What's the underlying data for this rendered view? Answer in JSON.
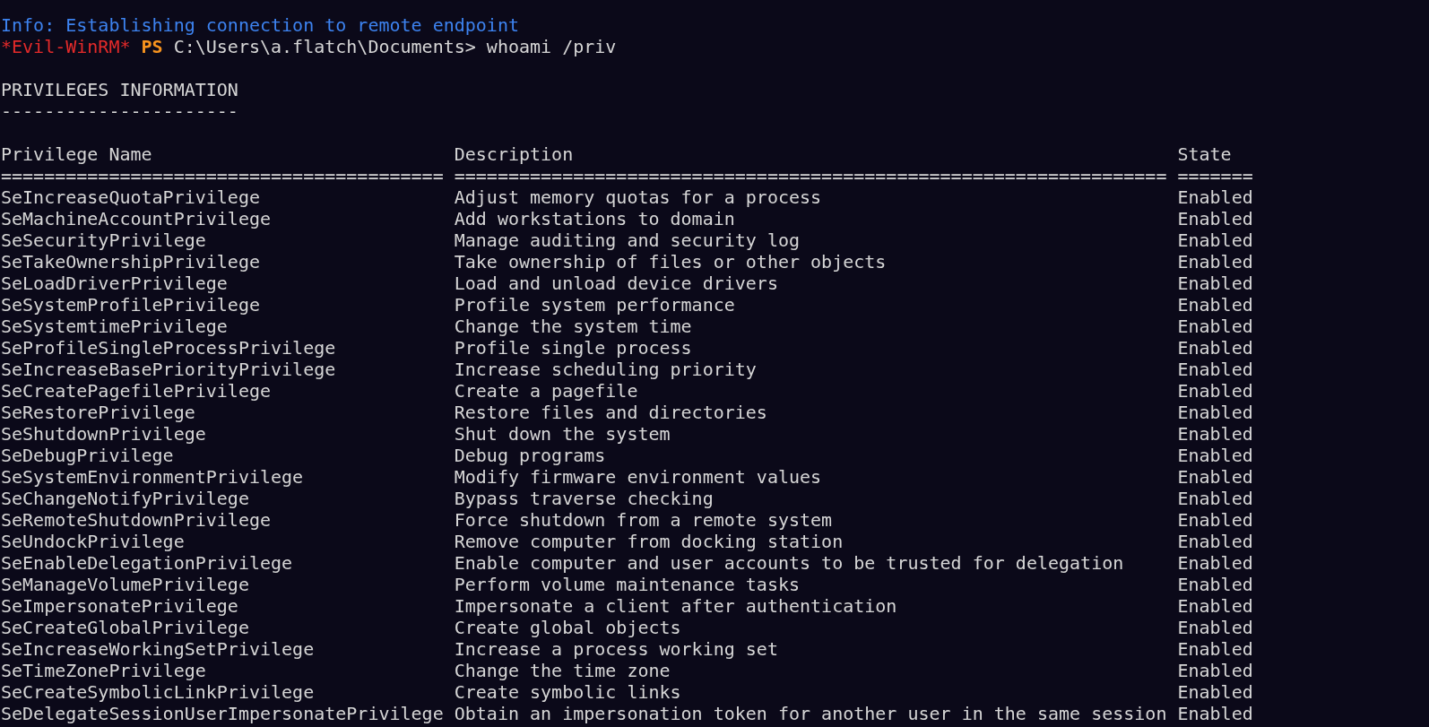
{
  "info_line": "Info: Establishing connection to remote endpoint",
  "prompt": {
    "shell_tag": "*Evil-WinRM*",
    "ps": "PS",
    "path": "C:\\Users\\a.flatch\\Documents>",
    "command": "whoami /priv"
  },
  "section": {
    "title": "PRIVILEGES INFORMATION",
    "underline": "----------------------"
  },
  "table": {
    "columns": [
      {
        "label": "Privilege Name",
        "rule": "========================================="
      },
      {
        "label": "Description",
        "rule": "=================================================================="
      },
      {
        "label": "State",
        "rule": "======="
      }
    ],
    "rows": [
      {
        "name": "SeIncreaseQuotaPrivilege",
        "description": "Adjust memory quotas for a process",
        "state": "Enabled"
      },
      {
        "name": "SeMachineAccountPrivilege",
        "description": "Add workstations to domain",
        "state": "Enabled"
      },
      {
        "name": "SeSecurityPrivilege",
        "description": "Manage auditing and security log",
        "state": "Enabled"
      },
      {
        "name": "SeTakeOwnershipPrivilege",
        "description": "Take ownership of files or other objects",
        "state": "Enabled"
      },
      {
        "name": "SeLoadDriverPrivilege",
        "description": "Load and unload device drivers",
        "state": "Enabled"
      },
      {
        "name": "SeSystemProfilePrivilege",
        "description": "Profile system performance",
        "state": "Enabled"
      },
      {
        "name": "SeSystemtimePrivilege",
        "description": "Change the system time",
        "state": "Enabled"
      },
      {
        "name": "SeProfileSingleProcessPrivilege",
        "description": "Profile single process",
        "state": "Enabled"
      },
      {
        "name": "SeIncreaseBasePriorityPrivilege",
        "description": "Increase scheduling priority",
        "state": "Enabled"
      },
      {
        "name": "SeCreatePagefilePrivilege",
        "description": "Create a pagefile",
        "state": "Enabled"
      },
      {
        "name": "SeRestorePrivilege",
        "description": "Restore files and directories",
        "state": "Enabled"
      },
      {
        "name": "SeShutdownPrivilege",
        "description": "Shut down the system",
        "state": "Enabled"
      },
      {
        "name": "SeDebugPrivilege",
        "description": "Debug programs",
        "state": "Enabled"
      },
      {
        "name": "SeSystemEnvironmentPrivilege",
        "description": "Modify firmware environment values",
        "state": "Enabled"
      },
      {
        "name": "SeChangeNotifyPrivilege",
        "description": "Bypass traverse checking",
        "state": "Enabled"
      },
      {
        "name": "SeRemoteShutdownPrivilege",
        "description": "Force shutdown from a remote system",
        "state": "Enabled"
      },
      {
        "name": "SeUndockPrivilege",
        "description": "Remove computer from docking station",
        "state": "Enabled"
      },
      {
        "name": "SeEnableDelegationPrivilege",
        "description": "Enable computer and user accounts to be trusted for delegation",
        "state": "Enabled"
      },
      {
        "name": "SeManageVolumePrivilege",
        "description": "Perform volume maintenance tasks",
        "state": "Enabled"
      },
      {
        "name": "SeImpersonatePrivilege",
        "description": "Impersonate a client after authentication",
        "state": "Enabled"
      },
      {
        "name": "SeCreateGlobalPrivilege",
        "description": "Create global objects",
        "state": "Enabled"
      },
      {
        "name": "SeIncreaseWorkingSetPrivilege",
        "description": "Increase a process working set",
        "state": "Enabled"
      },
      {
        "name": "SeTimeZonePrivilege",
        "description": "Change the time zone",
        "state": "Enabled"
      },
      {
        "name": "SeCreateSymbolicLinkPrivilege",
        "description": "Create symbolic links",
        "state": "Enabled"
      },
      {
        "name": "SeDelegateSessionUserImpersonatePrivilege",
        "description": "Obtain an impersonation token for another user in the same session",
        "state": "Enabled"
      }
    ]
  }
}
